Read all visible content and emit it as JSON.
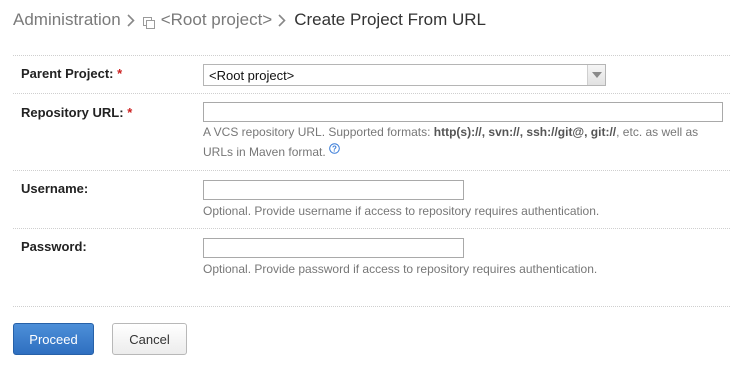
{
  "breadcrumb": {
    "admin": "Administration",
    "root": "<Root project>",
    "current": "Create Project From URL"
  },
  "form": {
    "parent_project": {
      "label": "Parent Project:",
      "required_mark": "*",
      "selected": "<Root project>"
    },
    "repo_url": {
      "label": "Repository URL:",
      "required_mark": "*",
      "value": "",
      "note_line1_prefix": "A VCS repository URL. Supported formats: ",
      "formats": [
        "http(s)://",
        ", svn://",
        ", ssh://git@",
        ", git://"
      ],
      "note_line1_suffix": ", etc. as well as",
      "note_line2": "URLs in Maven format."
    },
    "username": {
      "label": "Username:",
      "value": "",
      "note": "Optional. Provide username if access to repository requires authentication."
    },
    "password": {
      "label": "Password:",
      "value": "",
      "note": "Optional. Provide password if access to repository requires authentication."
    }
  },
  "buttons": {
    "proceed": "Proceed",
    "cancel": "Cancel"
  },
  "icons": {
    "breadcrumb_separator": "chevron-right-icon",
    "project": "project-icon",
    "select_arrow": "chevron-down-icon",
    "help": "help-icon"
  },
  "colors": {
    "primary_button": "#3a7bd0",
    "required_mark": "#cc1f1f",
    "help_icon": "#3b7dd8"
  }
}
